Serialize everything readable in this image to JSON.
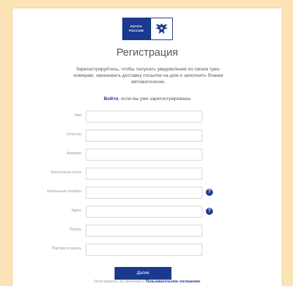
{
  "logo": {
    "line1": "ПОЧТА",
    "line2": "РОССИИ"
  },
  "title": "Регистрация",
  "intro": "Зарегистрируйтесь, чтобы получать уведомления по своим трек-номерам, заказывать доставку посылок на дом и заполнять бланки автоматически.",
  "login": {
    "link": "Войти",
    "rest": ", если вы уже зарегистрированы"
  },
  "fields": {
    "name": {
      "label": "Имя",
      "value": ""
    },
    "patronymic": {
      "label": "Отчество",
      "value": ""
    },
    "surname": {
      "label": "Фамилия",
      "value": ""
    },
    "email": {
      "label": "Электронная почта",
      "value": ""
    },
    "phone": {
      "label": "Мобильный телефон",
      "value": ""
    },
    "address": {
      "label": "Адрес",
      "value": ""
    },
    "password": {
      "label": "Пароль",
      "value": ""
    },
    "password_repeat": {
      "label": "Повторите пароль",
      "value": ""
    }
  },
  "help_glyph": "?",
  "submit_label": "Далее",
  "terms": {
    "text": "Регистрируясь, вы принимаете ",
    "link": "Пользовательское соглашение"
  }
}
